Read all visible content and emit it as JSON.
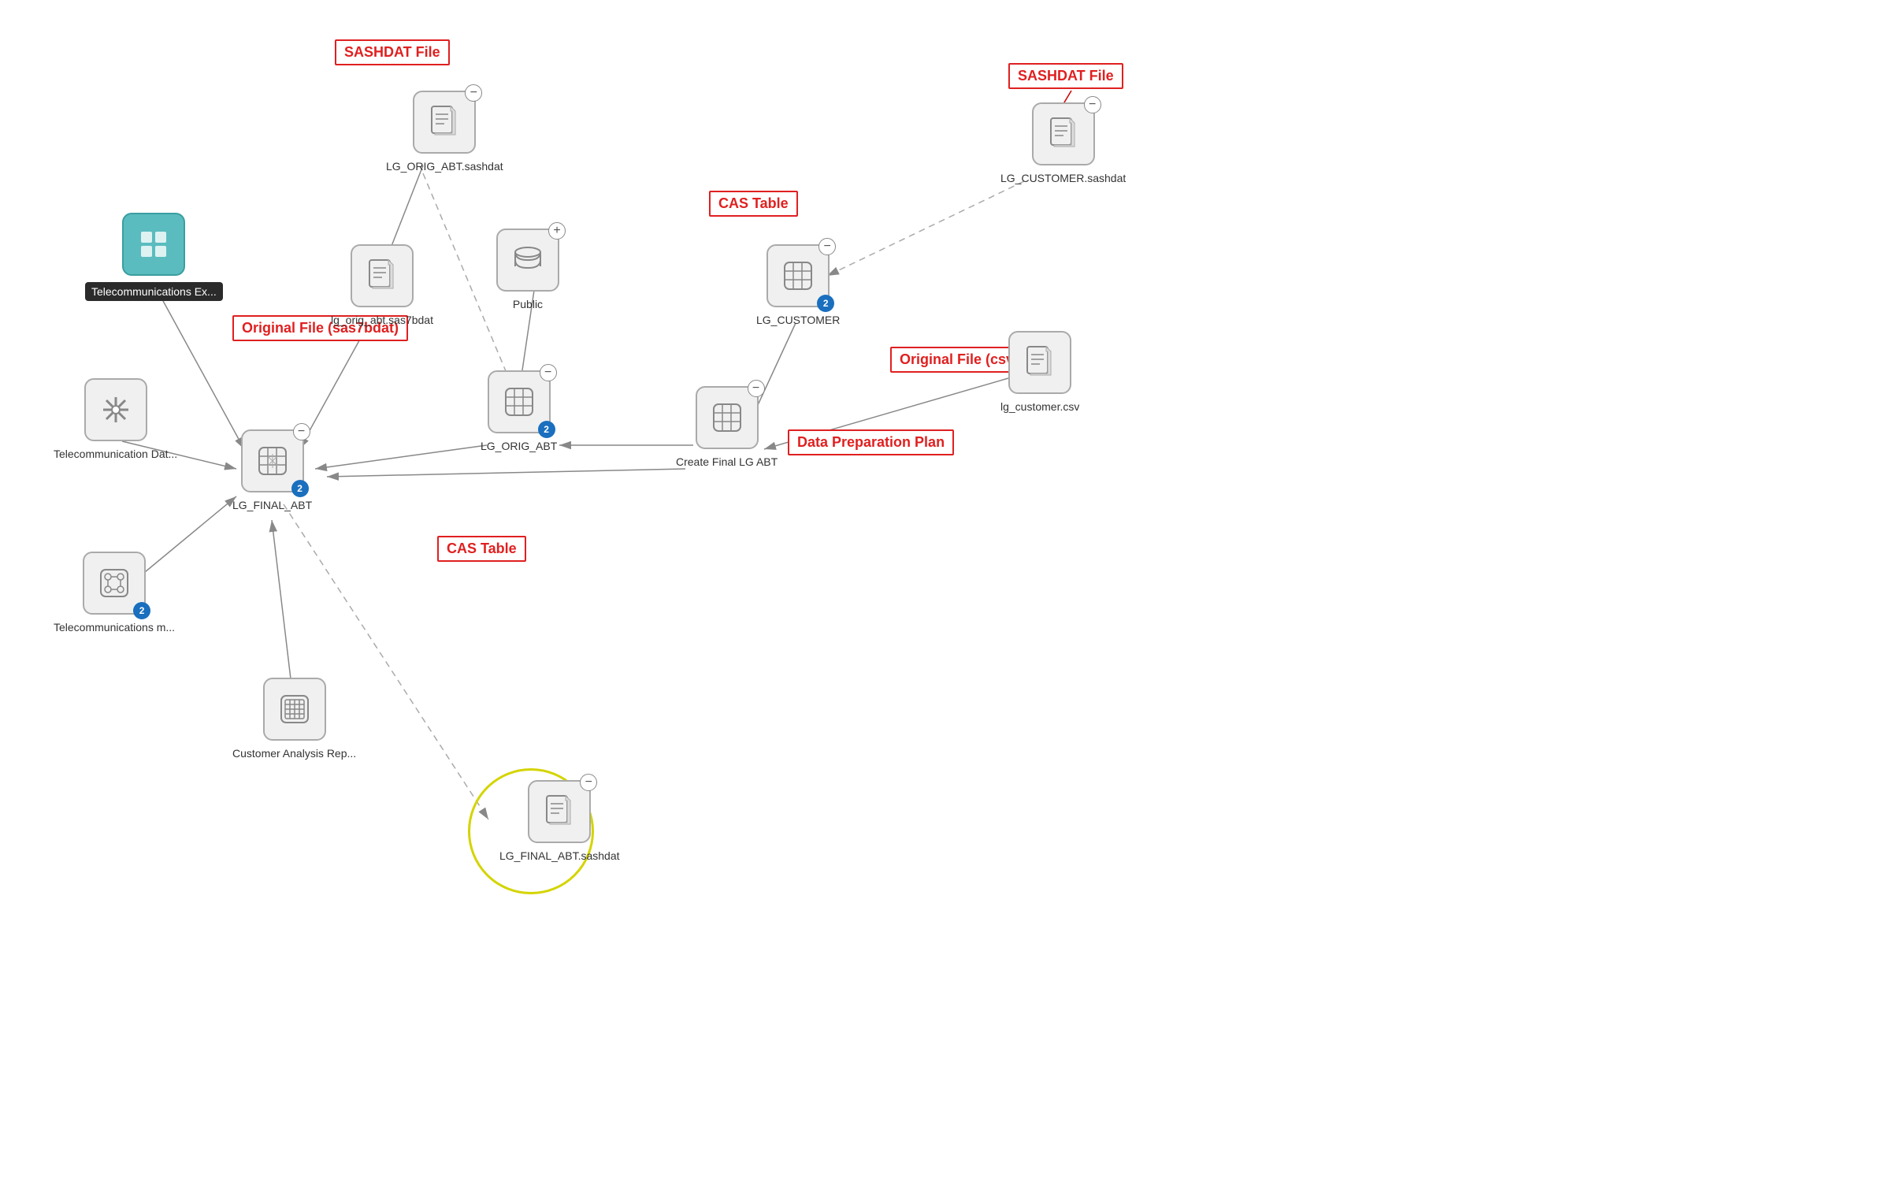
{
  "annotations": {
    "sashdat1": {
      "label": "SASHDAT File"
    },
    "sashdat2": {
      "label": "SASHDAT File"
    },
    "castable1": {
      "label": "CAS Table"
    },
    "castable2": {
      "label": "CAS Table"
    },
    "originalFileSas": {
      "label": "Original File (sas7bdat)"
    },
    "originalFileCsv": {
      "label": "Original File (csv)"
    },
    "dataPrepPlan": {
      "label": "Data Preparation Plan"
    }
  },
  "nodes": {
    "lgOrigAbtSashdat": {
      "label": "LG_ORIG_ABT.sashdat"
    },
    "telecomEx": {
      "label": "Telecommunications Ex..."
    },
    "lgOrigAbtSas7bdat": {
      "label": "lg_orig_abt.sas7bdat"
    },
    "public": {
      "label": "Public"
    },
    "telecomDat": {
      "label": "Telecommunication Dat..."
    },
    "lgOrigAbtCas": {
      "label": "LG_ORIG_ABT",
      "badge": "2"
    },
    "lgFinalAbt": {
      "label": "LG_FINAL_ABT",
      "badge": "2"
    },
    "lgCustomer": {
      "label": "LG_CUSTOMER",
      "badge": "2"
    },
    "lgCustomerSashdat": {
      "label": "LG_CUSTOMER.sashdat"
    },
    "createFinalLgAbt": {
      "label": "Create Final LG ABT"
    },
    "lgCustomerCsv": {
      "label": "lg_customer.csv"
    },
    "telecomModel": {
      "label": "Telecommunications m...",
      "badge": "2"
    },
    "customerAnalysisRep": {
      "label": "Customer Analysis Rep..."
    },
    "lgFinalAbtSashdat": {
      "label": "LG_FINAL_ABT.sashdat"
    }
  }
}
